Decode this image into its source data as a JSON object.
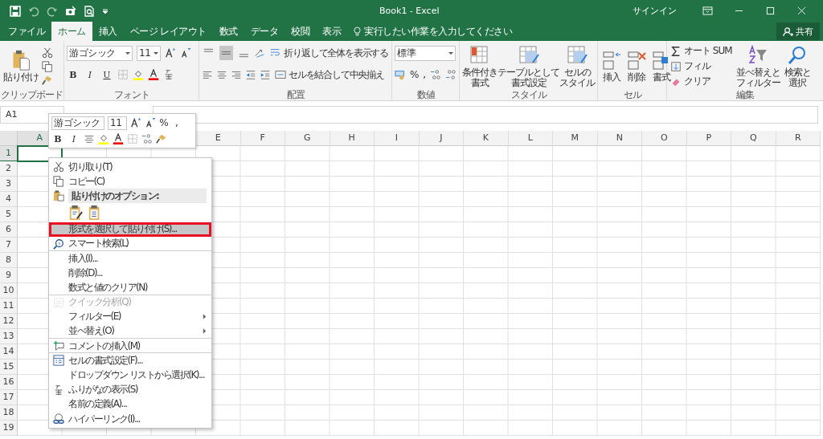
{
  "title_bar": {
    "title": "Book1 - Excel",
    "sign_in": "サインイン"
  },
  "tabs": [
    {
      "label": "ファイル",
      "selected": false
    },
    {
      "label": "ホーム",
      "selected": true
    },
    {
      "label": "挿入",
      "selected": false
    },
    {
      "label": "ページ レイアウト",
      "selected": false
    },
    {
      "label": "数式",
      "selected": false
    },
    {
      "label": "データ",
      "selected": false
    },
    {
      "label": "校閲",
      "selected": false
    },
    {
      "label": "表示",
      "selected": false
    }
  ],
  "tell_me": {
    "placeholder": "実行したい作業を入力してください"
  },
  "share": "共有",
  "ribbon": {
    "clipboard": {
      "paste": "貼り付け",
      "label": "クリップボード"
    },
    "font": {
      "font_name": "游ゴシック",
      "font_size": "11",
      "style_buttons": [
        "B",
        "I",
        "U"
      ],
      "label": "フォント"
    },
    "alignment": {
      "vertical_align": [
        {
          "selected": false
        },
        {
          "selected": true
        },
        {
          "selected": false
        }
      ],
      "wrap": "折り返して全体を表示する",
      "merge": "セルを結合して中央揃え",
      "label": "配置"
    },
    "number": {
      "format": "標準",
      "percent": "%",
      "comma": ",",
      "label": "数値"
    },
    "styles": {
      "buttons": [
        {
          "line1": "条件付き",
          "line2": "書式"
        },
        {
          "line1": "テーブルとして",
          "line2": "書式設定"
        },
        {
          "line1": "セルの",
          "line2": "スタイル"
        }
      ],
      "label": "スタイル"
    },
    "cells": {
      "buttons": [
        "挿入",
        "削除",
        "書式"
      ],
      "label": "セル"
    },
    "editing": {
      "autosum": "オート SUM",
      "fill": "フィル",
      "clear": "クリア",
      "sort": {
        "line1": "並べ替えと",
        "line2": "フィルター"
      },
      "find": {
        "line1": "検索と",
        "line2": "選択"
      },
      "label": "編集"
    }
  },
  "name_box": "A1",
  "columns": [
    {
      "label": "A",
      "selected": true
    },
    {
      "label": "E",
      "selected": false
    },
    {
      "label": "F",
      "selected": false
    },
    {
      "label": "G",
      "selected": false
    },
    {
      "label": "H",
      "selected": false
    },
    {
      "label": "I",
      "selected": false
    },
    {
      "label": "J",
      "selected": false
    },
    {
      "label": "K",
      "selected": false
    },
    {
      "label": "L",
      "selected": false
    },
    {
      "label": "M",
      "selected": false
    },
    {
      "label": "N",
      "selected": false
    },
    {
      "label": "O",
      "selected": false
    },
    {
      "label": "P",
      "selected": false
    },
    {
      "label": "Q",
      "selected": false
    },
    {
      "label": "R",
      "selected": false
    }
  ],
  "rows": [
    {
      "label": "1",
      "selected": true
    },
    {
      "label": "2",
      "selected": false
    },
    {
      "label": "3",
      "selected": false
    },
    {
      "label": "4",
      "selected": false
    },
    {
      "label": "5",
      "selected": false
    },
    {
      "label": "6",
      "selected": false
    },
    {
      "label": "7",
      "selected": false
    },
    {
      "label": "8",
      "selected": false
    },
    {
      "label": "9",
      "selected": false
    },
    {
      "label": "10",
      "selected": false
    },
    {
      "label": "11",
      "selected": false
    },
    {
      "label": "12",
      "selected": false
    },
    {
      "label": "13",
      "selected": false
    },
    {
      "label": "14",
      "selected": false
    },
    {
      "label": "15",
      "selected": false
    },
    {
      "label": "16",
      "selected": false
    },
    {
      "label": "17",
      "selected": false
    },
    {
      "label": "18",
      "selected": false
    },
    {
      "label": "19",
      "selected": false
    }
  ],
  "mini_toolbar": {
    "font_name": "游ゴシック",
    "font_size": "11",
    "percent": "%",
    "comma": ",",
    "style_buttons": [
      "B",
      "I"
    ]
  },
  "context_menu": [
    {
      "kind": "item",
      "label": "切り取り(T)",
      "selected": false,
      "disabled": false,
      "submenu": false,
      "separator_after": false
    },
    {
      "kind": "item",
      "label": "コピー(C)",
      "selected": false,
      "disabled": false,
      "submenu": false,
      "separator_after": false
    },
    {
      "kind": "header",
      "label": "貼り付けのオプション:",
      "selected": false,
      "disabled": false,
      "submenu": false,
      "separator_after": false
    },
    {
      "kind": "paste_options",
      "selected": false,
      "disabled": false,
      "submenu": false,
      "separator_after": false
    },
    {
      "kind": "item",
      "label": "形式を選択して貼り付け(S)...",
      "selected": true,
      "disabled": false,
      "submenu": false,
      "separator_after": true
    },
    {
      "kind": "item",
      "label": "スマート検索(L)",
      "selected": false,
      "disabled": false,
      "submenu": false,
      "separator_after": true
    },
    {
      "kind": "item",
      "label": "挿入(I)...",
      "selected": false,
      "disabled": false,
      "submenu": false,
      "separator_after": false
    },
    {
      "kind": "item",
      "label": "削除(D)...",
      "selected": false,
      "disabled": false,
      "submenu": false,
      "separator_after": false
    },
    {
      "kind": "item",
      "label": "数式と値のクリア(N)",
      "selected": false,
      "disabled": false,
      "submenu": false,
      "separator_after": true
    },
    {
      "kind": "item",
      "label": "クイック分析(Q)",
      "selected": false,
      "disabled": true,
      "submenu": false,
      "separator_after": false
    },
    {
      "kind": "item",
      "label": "フィルター(E)",
      "selected": false,
      "disabled": false,
      "submenu": true,
      "separator_after": false
    },
    {
      "kind": "item",
      "label": "並べ替え(O)",
      "selected": false,
      "disabled": false,
      "submenu": true,
      "separator_after": true
    },
    {
      "kind": "item",
      "label": "コメントの挿入(M)",
      "selected": false,
      "disabled": false,
      "submenu": false,
      "separator_after": true
    },
    {
      "kind": "item",
      "label": "セルの書式設定(F)...",
      "selected": false,
      "disabled": false,
      "submenu": false,
      "separator_after": false
    },
    {
      "kind": "item",
      "label": "ドロップダウン リストから選択(K)...",
      "selected": false,
      "disabled": false,
      "submenu": false,
      "separator_after": false
    },
    {
      "kind": "item",
      "label": "ふりがなの表示(S)",
      "selected": false,
      "disabled": false,
      "submenu": false,
      "separator_after": false
    },
    {
      "kind": "item",
      "label": "名前の定義(A)...",
      "selected": false,
      "disabled": false,
      "submenu": false,
      "separator_after": false
    },
    {
      "kind": "item",
      "label": "ハイパーリンク(I)...",
      "selected": false,
      "disabled": false,
      "submenu": false,
      "separator_after": false
    }
  ]
}
